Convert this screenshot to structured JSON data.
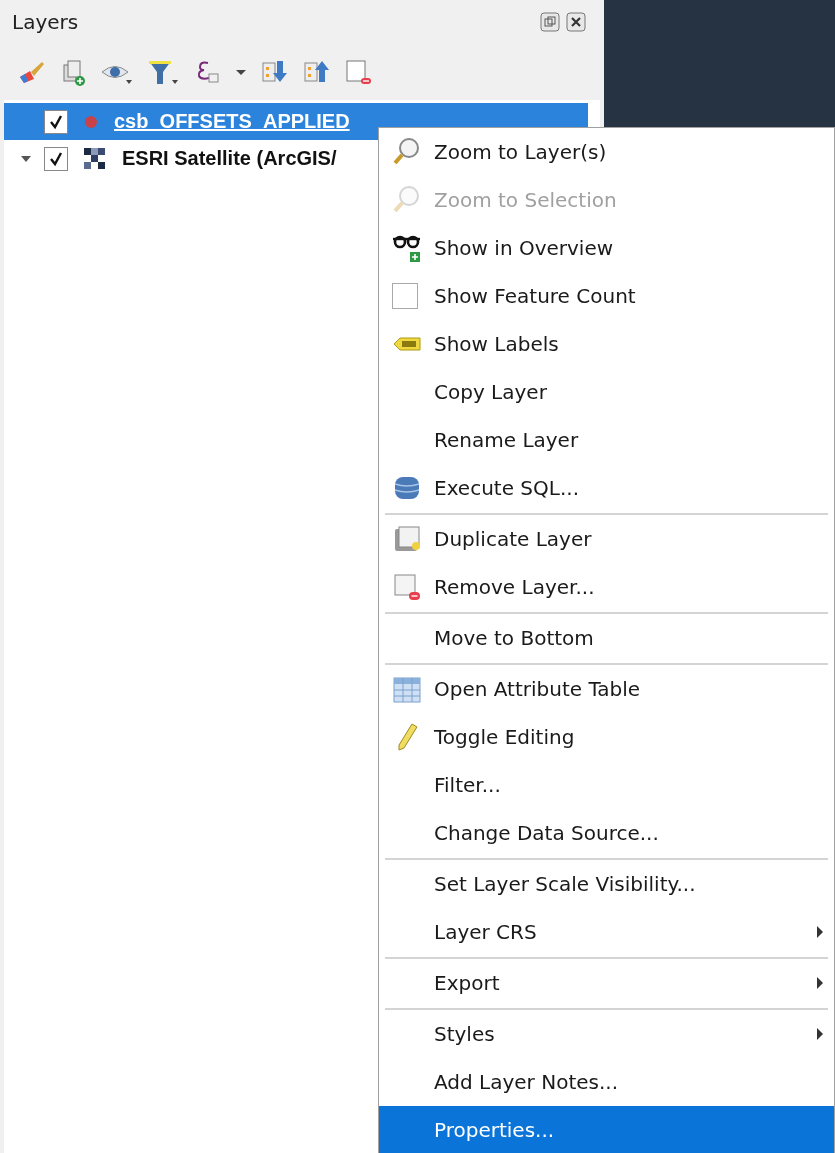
{
  "panel": {
    "title": "Layers"
  },
  "layers": [
    {
      "name": "csb_OFFSETS_APPLIED",
      "checked": true,
      "selected": true,
      "kind": "vector"
    },
    {
      "name": "ESRI Satellite (ArcGIS/",
      "checked": true,
      "selected": false,
      "kind": "raster",
      "expanded": true
    }
  ],
  "context_menu": {
    "groups": [
      [
        {
          "label": "Zoom to Layer(s)",
          "kind": "action",
          "disabled": false,
          "selected": false
        },
        {
          "label": "Zoom to Selection",
          "kind": "action",
          "disabled": true,
          "selected": false
        },
        {
          "label": "Show in Overview",
          "kind": "action",
          "disabled": false,
          "selected": false
        },
        {
          "label": "Show Feature Count",
          "kind": "checkbox",
          "checked": false,
          "disabled": false,
          "selected": false
        },
        {
          "label": "Show Labels",
          "kind": "action",
          "disabled": false,
          "selected": false
        },
        {
          "label": "Copy Layer",
          "kind": "action",
          "disabled": false,
          "selected": false
        },
        {
          "label": "Rename Layer",
          "kind": "action",
          "disabled": false,
          "selected": false
        },
        {
          "label": "Execute SQL...",
          "kind": "action",
          "disabled": false,
          "selected": false
        }
      ],
      [
        {
          "label": "Duplicate Layer",
          "kind": "action",
          "disabled": false,
          "selected": false
        },
        {
          "label": "Remove Layer...",
          "kind": "action",
          "disabled": false,
          "selected": false
        }
      ],
      [
        {
          "label": "Move to Bottom",
          "kind": "action",
          "disabled": false,
          "selected": false
        }
      ],
      [
        {
          "label": "Open Attribute Table",
          "kind": "action",
          "disabled": false,
          "selected": false
        },
        {
          "label": "Toggle Editing",
          "kind": "action",
          "disabled": false,
          "selected": false
        },
        {
          "label": "Filter...",
          "kind": "action",
          "disabled": false,
          "selected": false
        },
        {
          "label": "Change Data Source...",
          "kind": "action",
          "disabled": false,
          "selected": false
        }
      ],
      [
        {
          "label": "Set Layer Scale Visibility...",
          "kind": "action",
          "disabled": false,
          "selected": false
        },
        {
          "label": "Layer CRS",
          "kind": "submenu",
          "disabled": false,
          "selected": false
        }
      ],
      [
        {
          "label": "Export",
          "kind": "submenu",
          "disabled": false,
          "selected": false
        }
      ],
      [
        {
          "label": "Styles",
          "kind": "submenu",
          "disabled": false,
          "selected": false
        },
        {
          "label": "Add Layer Notes...",
          "kind": "action",
          "disabled": false,
          "selected": false
        },
        {
          "label": "Properties...",
          "kind": "action",
          "disabled": false,
          "selected": true
        }
      ]
    ]
  }
}
